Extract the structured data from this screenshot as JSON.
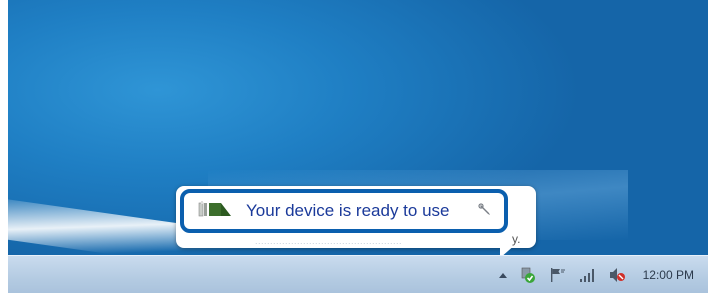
{
  "notification": {
    "message": "Your device is ready to use",
    "subtext": "................................................."
  },
  "taskbar": {
    "clock": "12:00 PM"
  },
  "icons": {
    "device": "device-icon",
    "wrench": "wrench-icon",
    "show_hidden": "show-hidden-icons-arrow",
    "usb_ok": "device-ready-icon",
    "action_center": "flag-icon",
    "network": "signal-bars-icon",
    "volume": "volume-muted-icon"
  },
  "colors": {
    "highlight_border": "#0b5fae",
    "message_text": "#1b3a9a",
    "desktop": "#1f7fc4",
    "taskbar": "#b4cbe2"
  }
}
